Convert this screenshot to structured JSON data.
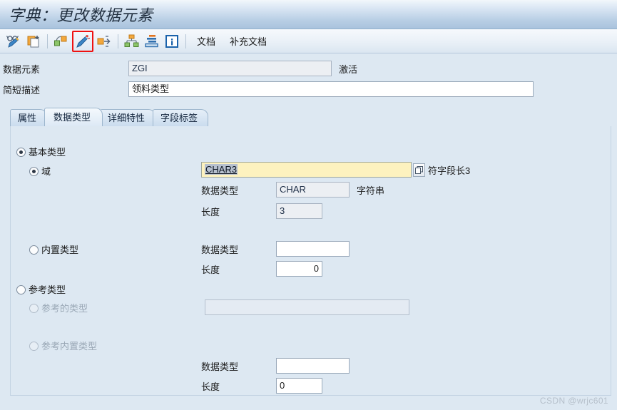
{
  "window": {
    "title": "字典：更改数据元素"
  },
  "toolbar": {
    "icons": [
      {
        "name": "display-change-icon",
        "label": "显示/更改"
      },
      {
        "name": "copy-document-icon",
        "label": "复制"
      },
      {
        "name": "other-object-icon",
        "label": "其它对象"
      },
      {
        "name": "edit-wand-icon",
        "label": "更改",
        "highlighted": true
      },
      {
        "name": "expand-arrows-icon",
        "label": "展开"
      },
      {
        "name": "hierarchy-icon",
        "label": "层次"
      },
      {
        "name": "layers-icon",
        "label": "激活"
      },
      {
        "name": "info-icon",
        "label": "信息"
      }
    ],
    "buttons": [
      {
        "name": "documentation-button",
        "label": "文档"
      },
      {
        "name": "supplementary-documentation-button",
        "label": "补充文档"
      }
    ]
  },
  "header": {
    "data_element_label": "数据元素",
    "data_element_value": "ZGI",
    "status_label": "激活",
    "short_desc_label": "简短描述",
    "short_desc_value": "领料类型"
  },
  "tabs": [
    {
      "label": "属性",
      "active": false
    },
    {
      "label": "数据类型",
      "active": true
    },
    {
      "label": "详细特性",
      "active": false
    },
    {
      "label": "字段标签",
      "active": false
    }
  ],
  "panel": {
    "elementary_type": {
      "label": "基本类型",
      "selected": true
    },
    "domain": {
      "label": "域",
      "selected": true,
      "value": "CHAR3",
      "value_selected": true,
      "hint": "符字段长3",
      "data_type_label": "数据类型",
      "data_type_value": "CHAR",
      "data_type_hint": "字符串",
      "length_label": "长度",
      "length_value": "3"
    },
    "builtin_type": {
      "label": "内置类型",
      "selected": false,
      "data_type_label": "数据类型",
      "data_type_value": "",
      "length_label": "长度",
      "length_value": "0"
    },
    "reference_type": {
      "label": "参考类型",
      "selected": false
    },
    "referenced_type": {
      "label": "参考的类型",
      "selected": false,
      "disabled": true,
      "value": ""
    },
    "reference_builtin_type": {
      "label": "参考内置类型",
      "selected": false,
      "disabled": true,
      "data_type_label": "数据类型",
      "data_type_value": "",
      "length_label": "长度",
      "length_value": "0"
    }
  },
  "watermark": "CSDN @wrjc601"
}
